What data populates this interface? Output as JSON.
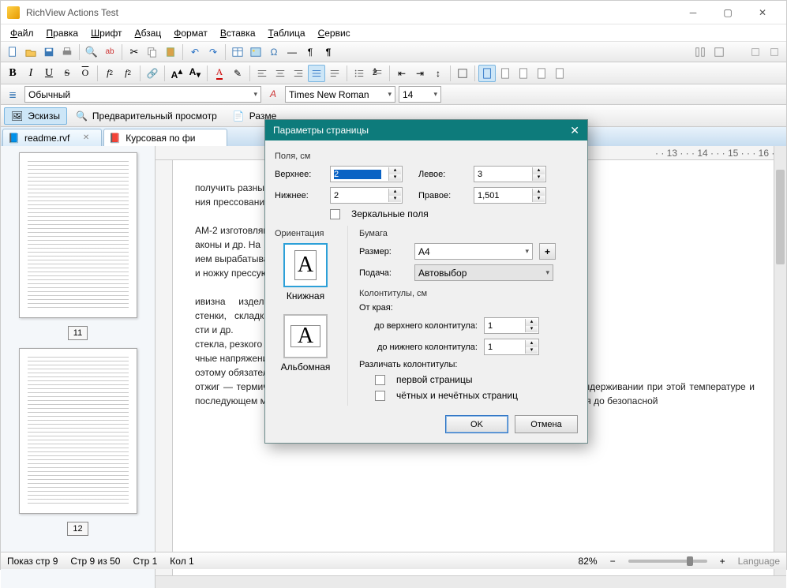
{
  "app": {
    "title": "RichView Actions Test"
  },
  "menu": [
    "Файл",
    "Правка",
    "Шрифт",
    "Абзац",
    "Формат",
    "Вставка",
    "Таблица",
    "Сервис"
  ],
  "style": {
    "paragraph_style": "Обычный",
    "font_name": "Times New Roman",
    "font_size": "14"
  },
  "viewbar": {
    "thumbs": "Эскизы",
    "preview": "Предварительный просмотр",
    "pagesize": "Разме"
  },
  "tabs": [
    {
      "label": "readme.rvf",
      "active": false
    },
    {
      "label": "Курсовая по фи",
      "active": true
    }
  ],
  "thumbs_pages": [
    "11",
    "12"
  ],
  "ruler_right": "· · 13 · · · 14 · · · 15 · · · 16 · · ·",
  "document_text": "получить разный у\nния прессования и\n\nАМ-2 изготовляют\nаконы и др. На\nием вырабатывают\nи ножку прессуют\n\nивизна     изделий,\nстенки,   складки,\nсти и др.\nстекла, резкого и\nчные напряжения,\nоэтому обязателен\nотжиг — термическая обработка, состоящая в нагревании изделий до 530—550 °C, выдерживании при этой температуре и последующем медленном охлаждении. При отжиге остаточные напряжения ослабляются до безопасной",
  "status": {
    "show_page": "Показ стр 9",
    "page_of": "Стр 9 из 50",
    "line": "Стр 1",
    "col": "Кол 1",
    "zoom": "82%",
    "lang": "Language"
  },
  "dialog": {
    "title": "Параметры страницы",
    "fields_label": "Поля, см",
    "top_lbl": "Верхнее:",
    "top_val": "2",
    "bottom_lbl": "Нижнее:",
    "bottom_val": "2",
    "left_lbl": "Левое:",
    "left_val": "3",
    "right_lbl": "Правое:",
    "right_val": "1,501",
    "mirror": "Зеркальные поля",
    "orient_label": "Ориентация",
    "portrait": "Книжная",
    "landscape": "Альбомная",
    "paper_label": "Бумага",
    "size_lbl": "Размер:",
    "size_val": "A4",
    "feed_lbl": "Подача:",
    "feed_val": "Автовыбор",
    "headers_label": "Колонтитулы, см",
    "from_edge": "От края:",
    "to_header": "до верхнего колонтитула:",
    "header_val": "1",
    "to_footer": "до нижнего колонтитула:",
    "footer_val": "1",
    "diff_headers": "Различать колонтитулы:",
    "first_page": "первой страницы",
    "odd_even": "чётных и нечётных страниц",
    "ok": "OK",
    "cancel": "Отмена"
  }
}
